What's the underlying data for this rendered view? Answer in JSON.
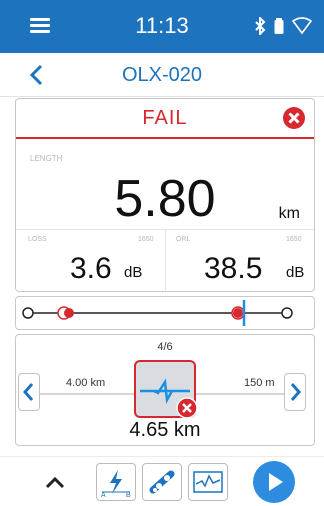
{
  "status_bar": {
    "time": "11:13",
    "icons": [
      "menu-icon",
      "bluetooth-icon",
      "battery-icon",
      "wifi-icon"
    ]
  },
  "header": {
    "title": "OLX-020",
    "back_icon": "chevron-left-icon"
  },
  "result": {
    "status": "FAIL",
    "status_color": "#d7282f",
    "length_label": "LENGTH",
    "length_value": "5.80",
    "length_unit": "km",
    "loss_label": "LOSS",
    "loss_wavelength": "1650",
    "loss_value": "3.6",
    "loss_unit": "dB",
    "orl_label": "ORL",
    "orl_wavelength": "1650",
    "orl_value": "38.5",
    "orl_unit": "dB"
  },
  "event_nav": {
    "counter": "4/6",
    "left_distance": "4.00 km",
    "right_distance": "150 m",
    "event_distance": "4.65 km"
  },
  "toolbar": {
    "items": [
      "chevron-up-icon",
      "ab-measure-icon",
      "link-map-icon",
      "trace-view-icon",
      "play-icon"
    ]
  },
  "colors": {
    "accent": "#1e73be",
    "fail": "#d7282f",
    "marker": "#1e8fe0"
  }
}
